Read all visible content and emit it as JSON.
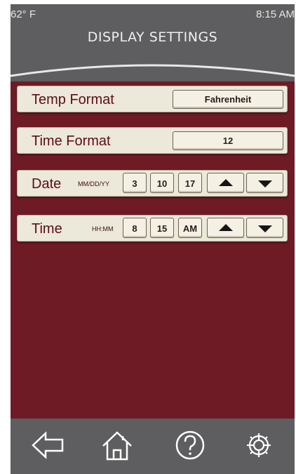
{
  "status_bar": {
    "temperature": "62° F",
    "time": "8:15 AM"
  },
  "header": {
    "title": "DISPLAY SETTINGS"
  },
  "settings": {
    "temp_format": {
      "label": "Temp Format",
      "value": "Fahrenheit"
    },
    "time_format": {
      "label": "Time Format",
      "value": "12"
    },
    "date": {
      "label": "Date",
      "format_hint": "MM/DD/YY",
      "month": "3",
      "day": "10",
      "year": "17"
    },
    "time": {
      "label": "Time",
      "format_hint": "HH:MM",
      "hour": "8",
      "minute": "15",
      "period": "AM"
    }
  },
  "footer": {
    "icons": [
      "back-arrow-icon",
      "home-icon",
      "help-icon",
      "settings-gear-icon"
    ]
  },
  "colors": {
    "background": "#6e1b26",
    "header": "#5e5d5f",
    "row": "#ece8da",
    "label_text": "#5b0d18"
  }
}
